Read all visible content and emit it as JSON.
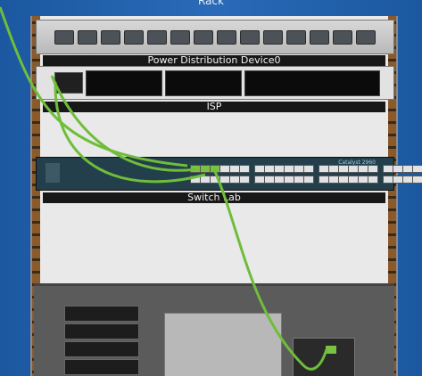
{
  "window": {
    "title": "Rack"
  },
  "devices": {
    "pdu": {
      "label": "Power Distribution Device0"
    },
    "isp": {
      "label": "ISP"
    },
    "switch": {
      "label": "Switch Lab",
      "model": "Catalyst 2960"
    }
  },
  "colors": {
    "background": "#1f5fa3",
    "cable": "#6fbd3a",
    "rail": "#8a5a2b"
  },
  "icons": [
    "cable-green",
    "power-outlet",
    "rj45-port"
  ]
}
